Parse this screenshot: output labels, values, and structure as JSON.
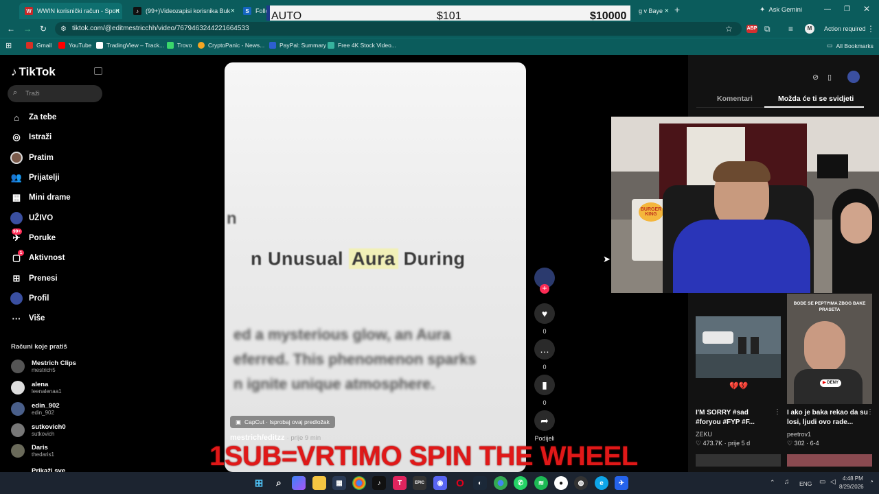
{
  "browser": {
    "tabs": [
      {
        "label": "WWIN korisnički račun - Sport",
        "icon": "W",
        "color": "#c62828"
      },
      {
        "label": "(99+)Videozapisi korisnika Buk",
        "icon": "♪",
        "color": "#111111"
      },
      {
        "label": "Follow",
        "icon": "S",
        "color": "#1565c0"
      },
      {
        "label": "g v Baye",
        "icon": "",
        "color": "#0b5c5c"
      }
    ],
    "new_tab": "+",
    "ask_gemini": "Ask Gemini",
    "url": "tiktok.com/@editmestricchh/video/7679463244221664533",
    "action_required": "Action required",
    "bookmarks": [
      {
        "label": "Gmail",
        "color": "#d93025"
      },
      {
        "label": "YouTube",
        "color": "#ff0000"
      },
      {
        "label": "TradingView – Track...",
        "color": "#ffffff"
      },
      {
        "label": "Trovo",
        "color": "#3ad66b"
      },
      {
        "label": "CryptoPanic - News...",
        "color": "#f5a623"
      },
      {
        "label": "PayPal: Summary",
        "color": "#2d5fd1"
      },
      {
        "label": "Free 4K Stock Video...",
        "color": "#36b39e"
      }
    ],
    "all_bookmarks": "All Bookmarks"
  },
  "overlay": {
    "mode": "AUTO",
    "value1": "$101",
    "value2": "$10000"
  },
  "tiktok": {
    "logo": "TikTok",
    "search_placeholder": "Traži",
    "nav": [
      {
        "label": "Za tebe",
        "icon": "home-icon"
      },
      {
        "label": "Istraži",
        "icon": "compass-icon"
      },
      {
        "label": "Pratim",
        "icon": "avatar-icon"
      },
      {
        "label": "Prijatelji",
        "icon": "friends-icon"
      },
      {
        "label": "Mini drame",
        "icon": "film-icon"
      },
      {
        "label": "UŽIVO",
        "icon": "live-icon"
      },
      {
        "label": "Poruke",
        "icon": "messages-icon",
        "badge": "99+"
      },
      {
        "label": "Aktivnost",
        "icon": "activity-icon",
        "badge": "1"
      },
      {
        "label": "Prenesi",
        "icon": "upload-icon"
      },
      {
        "label": "Profil",
        "icon": "profile-icon"
      },
      {
        "label": "Više",
        "icon": "more-icon"
      }
    ],
    "following_header": "Računi koje pratiš",
    "following": [
      {
        "name": "Mestrich Clips",
        "handle": "mestrich5"
      },
      {
        "name": "alena",
        "handle": "leenalenaa1"
      },
      {
        "name": "edin_902",
        "handle": "edin_902"
      },
      {
        "name": "sutkovich0",
        "handle": "sutkovich"
      },
      {
        "name": "Daris",
        "handle": "thedaris1"
      }
    ],
    "show_more": "Prikaži sve",
    "video": {
      "text_pre": "n Unusual",
      "text_highlight": "Aura",
      "text_post": "During",
      "blur_line1": "ed a mysterious glow, an Aura",
      "blur_line2": "eferred. This phenomenon sparks",
      "blur_line3": "n ignite unique atmosphere.",
      "capcut": "CapCut · Isprobaj ovaj predložak",
      "author": "mestrich/editzz",
      "time": "· prije 9 min"
    },
    "actions": {
      "likes": "0",
      "comments": "0",
      "saves": "0",
      "share": "Podijeli"
    },
    "right_tabs": [
      "Komentari",
      "Možda će ti se svidjeti"
    ],
    "webcam_sign": "BURGER KING",
    "cards": [
      {
        "title": "I'M SORRY #sad #foryou #FYP #F...",
        "author": "ZEKU",
        "stats": "473.7K · prije 5 d",
        "emoji": "💔💔"
      },
      {
        "title": "I ako je baka rekao da su losi, ljudi ovo rade...",
        "author": "peetrov1",
        "stats": "302 · 6-4",
        "thumb_text": "BODE SE PEPTI*IMA ZBOG BAKE PRASETA",
        "thumb_tag": "DENY"
      }
    ]
  },
  "stream_banner": "1SUB=VRTIMO SPIN THE WHEEL",
  "taskbar": {
    "lang": "ENG",
    "time": "4:48 PM",
    "date": "8/29/2026"
  }
}
